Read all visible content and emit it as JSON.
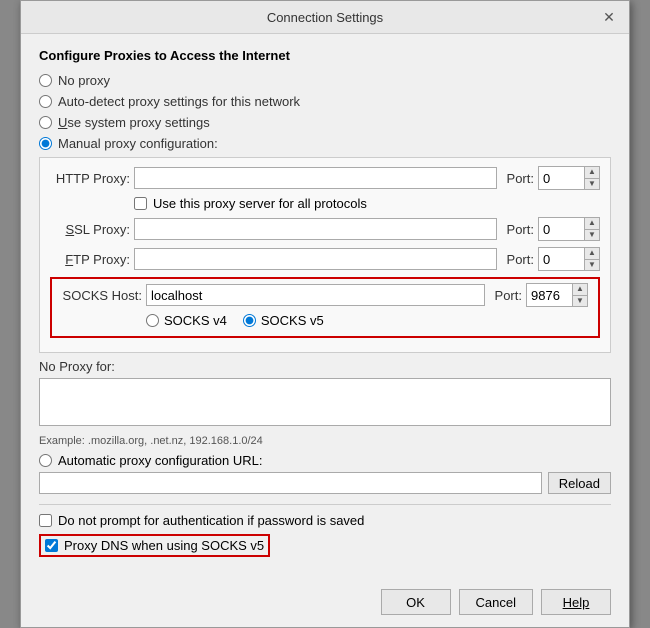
{
  "dialog": {
    "title": "Connection Settings",
    "close_icon": "✕"
  },
  "section": {
    "heading": "Configure Proxies to Access the Internet"
  },
  "proxy_options": [
    {
      "id": "no-proxy",
      "label": "No proxy",
      "checked": false
    },
    {
      "id": "auto-detect",
      "label": "Auto-detect proxy settings for this network",
      "checked": false
    },
    {
      "id": "system-proxy",
      "label": "Use system proxy settings",
      "checked": false
    },
    {
      "id": "manual-proxy",
      "label": "Manual proxy configuration:",
      "checked": true
    }
  ],
  "manual": {
    "http_proxy_label": "HTTP Proxy:",
    "http_proxy_value": "",
    "http_port_label": "Port:",
    "http_port_value": "0",
    "use_for_all_label": "Use this proxy server for all protocols",
    "ssl_proxy_label": "SSL Proxy:",
    "ssl_proxy_value": "",
    "ssl_port_label": "Port:",
    "ssl_port_value": "0",
    "ftp_proxy_label": "FTP Proxy:",
    "ftp_proxy_value": "",
    "ftp_port_label": "Port:",
    "ftp_port_value": "0",
    "socks_host_label": "SOCKS Host:",
    "socks_host_value": "localhost",
    "socks_port_label": "Port:",
    "socks_port_value": "9876",
    "socks_v4_label": "SOCKS v4",
    "socks_v5_label": "SOCKS v5",
    "socks_v4_checked": false,
    "socks_v5_checked": true
  },
  "no_proxy": {
    "label": "No Proxy for:",
    "value": ""
  },
  "example": {
    "text": "Example: .mozilla.org, .net.nz, 192.168.1.0/24"
  },
  "auto_proxy": {
    "label": "Automatic proxy configuration URL:",
    "value": "",
    "reload_label": "Reload"
  },
  "bottom": {
    "no_auth_label": "Do not prompt for authentication if password is saved",
    "proxy_dns_label": "Proxy DNS when using SOCKS v5"
  },
  "buttons": {
    "ok": "OK",
    "cancel": "Cancel",
    "help": "Help"
  }
}
